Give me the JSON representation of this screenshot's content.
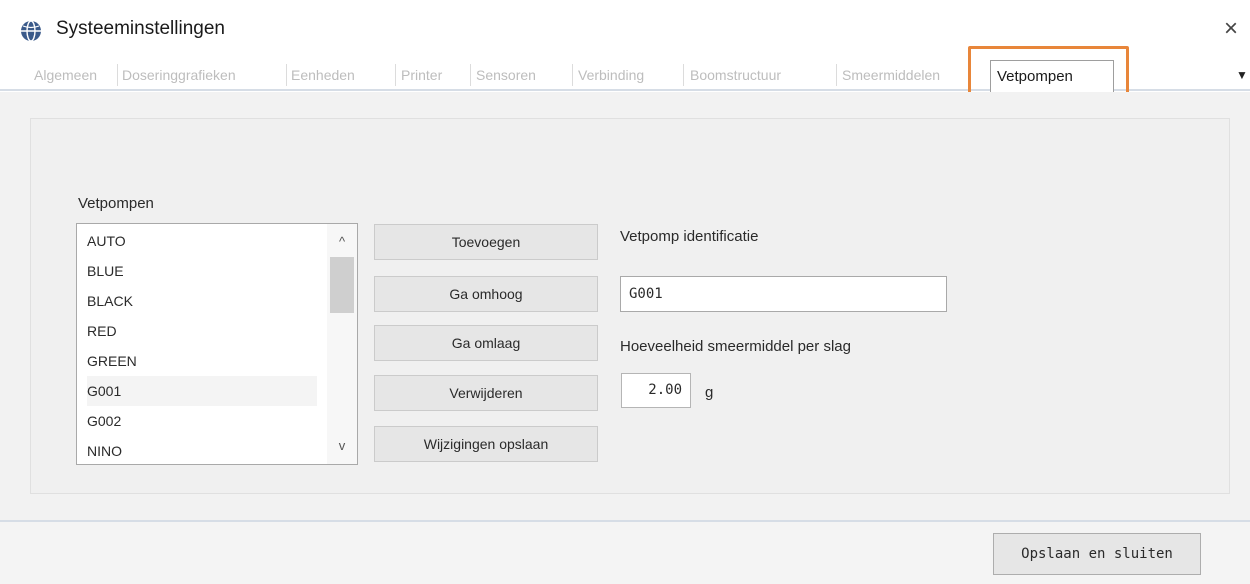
{
  "window": {
    "title": "Systeeminstellingen",
    "icon": "globe-app-icon",
    "close_glyph": "×"
  },
  "tabs": [
    {
      "label": "Algemeen"
    },
    {
      "label": "Doseringgrafieken"
    },
    {
      "label": "Eenheden"
    },
    {
      "label": "Printer"
    },
    {
      "label": "Sensoren"
    },
    {
      "label": "Verbinding"
    },
    {
      "label": "Boomstructuur"
    },
    {
      "label": "Smeermiddelen"
    }
  ],
  "active_tab": {
    "label": "Vetpompen"
  },
  "tab_dropdown_glyph": "▼",
  "highlight_color": "#e8863a",
  "list": {
    "label": "Vetpompen",
    "items": [
      "AUTO",
      "BLUE",
      "BLACK",
      "RED",
      "GREEN",
      "G001",
      "G002",
      "NINO"
    ],
    "selected": "G001",
    "scroll_up_glyph": "^",
    "scroll_down_glyph": "v"
  },
  "buttons": {
    "add": "Toevoegen",
    "up": "Ga omhoog",
    "down": "Ga omlaag",
    "delete": "Verwijderen",
    "save_changes": "Wijzigingen opslaan"
  },
  "identification": {
    "label": "Vetpomp identificatie",
    "value": "G001"
  },
  "quantity": {
    "label": "Hoeveelheid smeermiddel per slag",
    "value": "2.00",
    "unit": "g"
  },
  "footer": {
    "save_close": "Opslaan en sluiten"
  }
}
